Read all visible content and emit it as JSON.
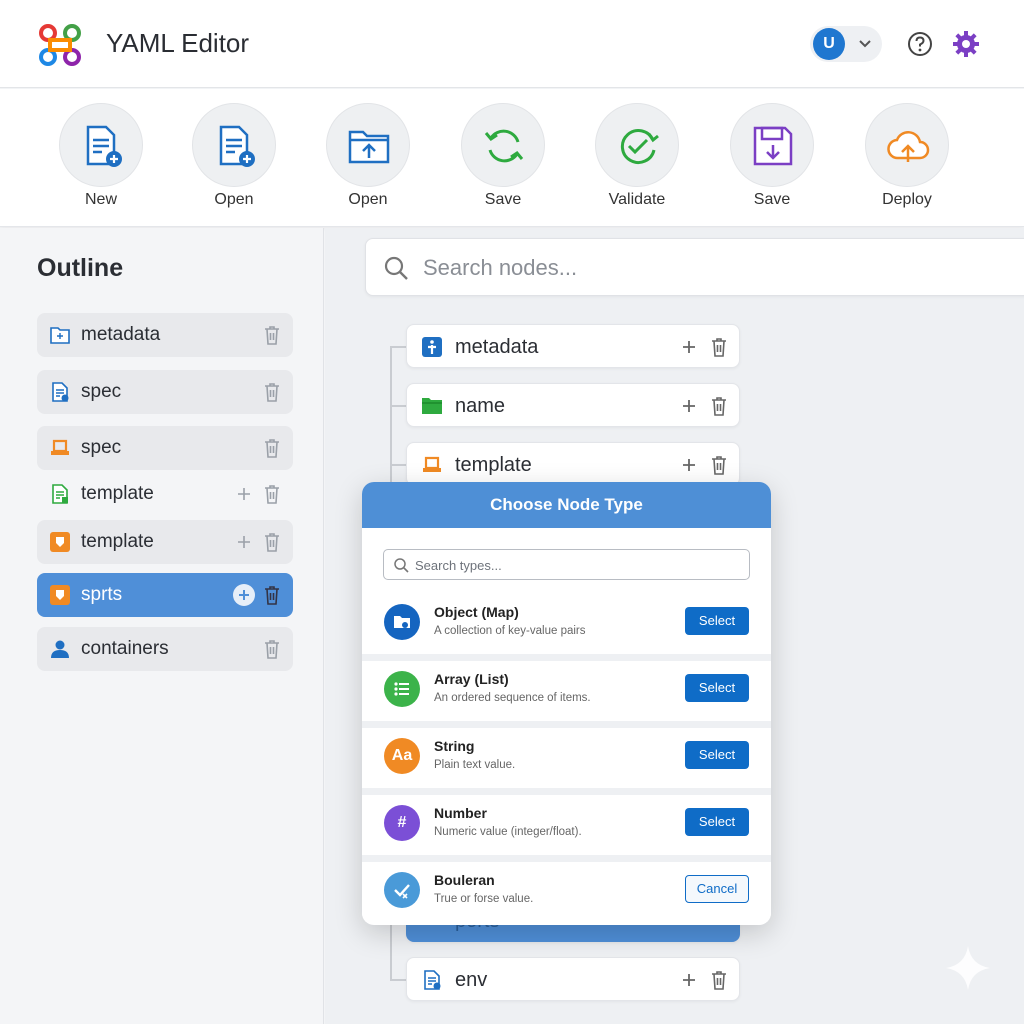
{
  "header": {
    "title": "YAML Editor",
    "avatar_letter": "U",
    "icons": [
      "logo",
      "chevron-down-icon",
      "help-icon",
      "gear-icon"
    ]
  },
  "toolbar": {
    "items": [
      {
        "label": "New",
        "icon": "new-file-icon"
      },
      {
        "label": "Open",
        "icon": "open-file-icon"
      },
      {
        "label": "Open",
        "icon": "open-folder-icon"
      },
      {
        "label": "Save",
        "icon": "sync-icon"
      },
      {
        "label": "Validate",
        "icon": "validate-icon"
      },
      {
        "label": "Save",
        "icon": "floppy-icon"
      },
      {
        "label": "Deploy",
        "icon": "cloud-upload-icon"
      }
    ]
  },
  "outline": {
    "title": "Outline",
    "items": [
      {
        "label": "metadata",
        "icon": "folder-icon"
      },
      {
        "label": "spec",
        "icon": "document-icon"
      },
      {
        "label": "spec",
        "icon": "box-icon"
      },
      {
        "label": "template",
        "icon": "document-icon"
      },
      {
        "label": "template",
        "icon": "package-icon"
      },
      {
        "label": "sprts",
        "icon": "package-icon",
        "selected": true
      },
      {
        "label": "containers",
        "icon": "user-icon"
      }
    ]
  },
  "search": {
    "placeholder": "Search nodes..."
  },
  "tree": {
    "nodes": [
      {
        "label": "metadata",
        "icon": "info-icon"
      },
      {
        "label": "name",
        "icon": "folder-icon"
      },
      {
        "label": "template",
        "icon": "box-icon"
      },
      {
        "label": "ports",
        "icon": "link-icon"
      },
      {
        "label": "env",
        "icon": "document-icon"
      }
    ]
  },
  "dialog": {
    "title": "Choose Node Type",
    "search_placeholder": "Search types...",
    "types": [
      {
        "name": "Object (Map)",
        "desc": "A collection of key-value pairs",
        "button": "Select",
        "color": "#1565c0",
        "icon_text": ""
      },
      {
        "name": "Array (List)",
        "desc": "An ordered sequence of items.",
        "button": "Select",
        "color": "#3cb34a",
        "icon_text": ""
      },
      {
        "name": "String",
        "desc": "Plain text value.",
        "button": "Select",
        "color": "#f08a24",
        "icon_text": "Aa"
      },
      {
        "name": "Number",
        "desc": "Numeric value (integer/float).",
        "button": "Select",
        "color": "#7b4fd6",
        "icon_text": "#"
      },
      {
        "name": "Bouleran",
        "desc": "True or forse value.",
        "button": "Cancel",
        "color": "#4a9ad8",
        "icon_text": ""
      }
    ]
  },
  "colors": {
    "accent": "#4e8fd6",
    "button": "#0f6cc7",
    "selected_outline": "#4f8fd8"
  }
}
